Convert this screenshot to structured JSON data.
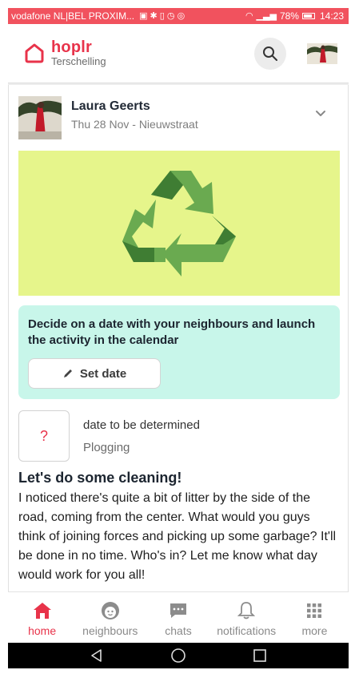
{
  "status_bar": {
    "carrier": "vodafone NL|BEL PROXIM...",
    "battery": "78%",
    "time": "14:23"
  },
  "header": {
    "brand": "hoplr",
    "neighbourhood": "Terschelling"
  },
  "post": {
    "author": "Laura Geerts",
    "meta": "Thu 28 Nov - Nieuwstraat",
    "callout": "Decide on a date with your neighbours and launch the activity in the calendar",
    "set_date_label": "Set date",
    "event_placeholder": "?",
    "event_date": "date to be determined",
    "event_type": "Plogging",
    "title": "Let's do some cleaning!",
    "body": "I noticed there's quite a bit of litter by the side of the road, coming from the center. What would you guys think of joining forces and picking up some garbage? It'll be done in no time. Who's in? Let me know what day would work for you all!"
  },
  "bottom_nav": [
    {
      "label": "home",
      "icon": "home-icon",
      "active": true
    },
    {
      "label": "neighbours",
      "icon": "face-icon",
      "active": false
    },
    {
      "label": "chats",
      "icon": "chat-icon",
      "active": false
    },
    {
      "label": "notifications",
      "icon": "bell-icon",
      "active": false
    },
    {
      "label": "more",
      "icon": "grid-icon",
      "active": false
    }
  ],
  "colors": {
    "accent": "#e8334a",
    "status_bar": "#f1525e",
    "hero_bg": "#e6f58b",
    "callout_bg": "#c8f6ea",
    "recycle_green": "#6aaa50"
  }
}
